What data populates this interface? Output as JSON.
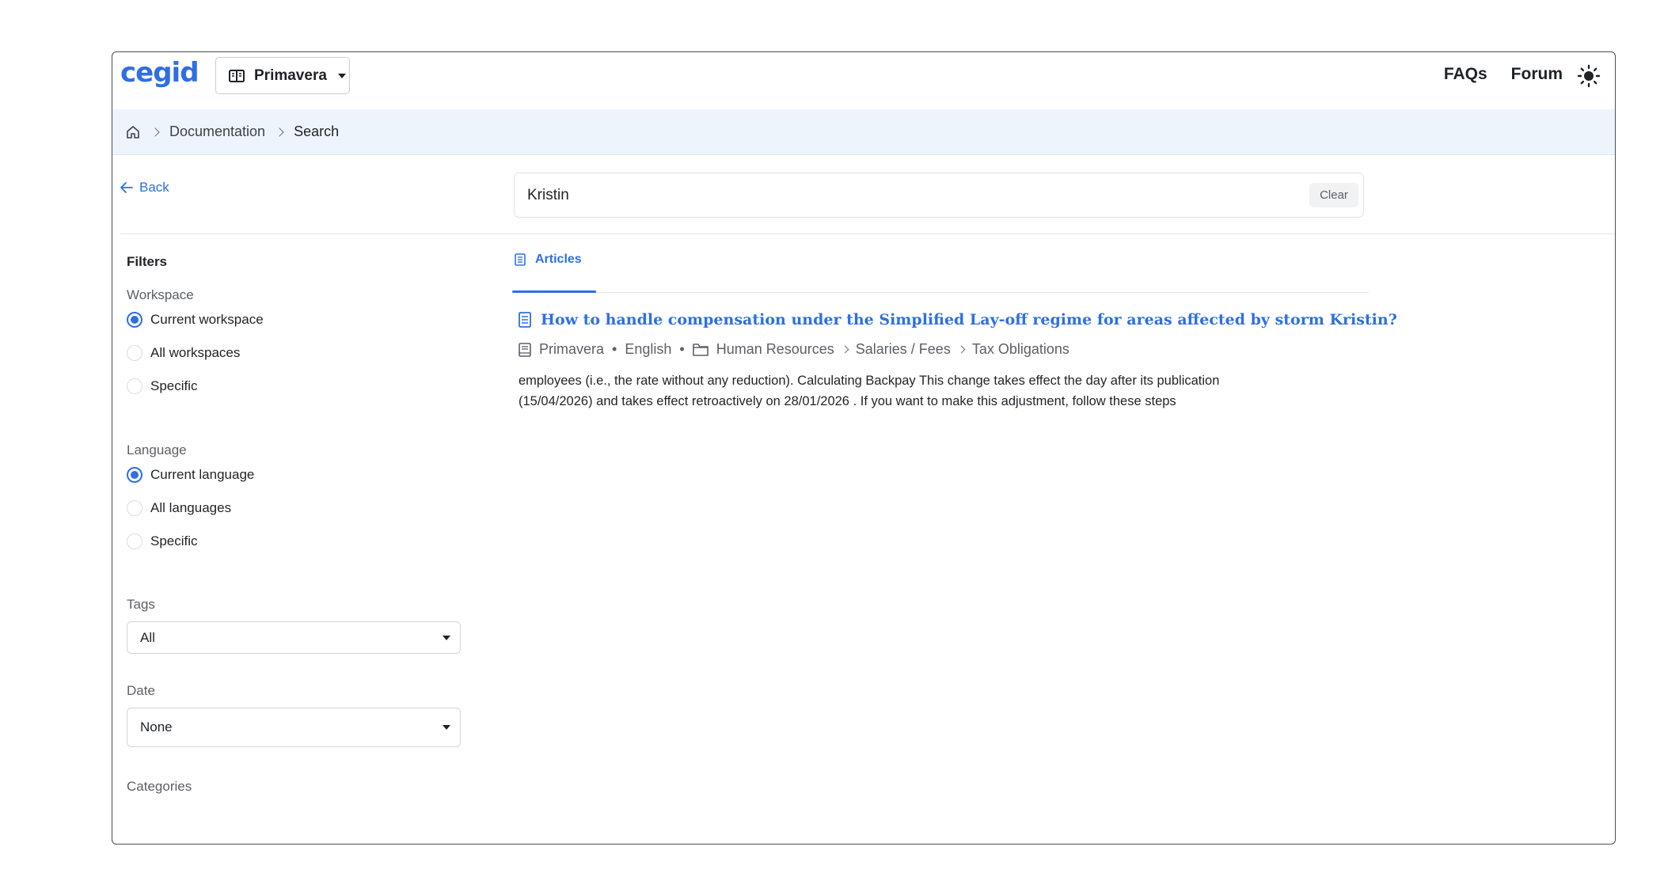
{
  "header": {
    "logo": "cegid",
    "workspace_label": "Primavera",
    "nav": [
      "FAQs",
      "Forum"
    ],
    "theme_icon": "sun-icon"
  },
  "breadcrumb": {
    "home_icon": "home-icon",
    "items": [
      "Documentation",
      "Search"
    ]
  },
  "back_label": "Back",
  "search": {
    "value": "Kristin",
    "clear_label": "Clear"
  },
  "filters": {
    "title": "Filters",
    "workspace": {
      "label": "Workspace",
      "options": [
        "Current workspace",
        "All workspaces",
        "Specific"
      ],
      "selected": "Current workspace"
    },
    "language": {
      "label": "Language",
      "options": [
        "Current language",
        "All languages",
        "Specific"
      ],
      "selected": "Current language"
    },
    "tags": {
      "label": "Tags",
      "value": "All"
    },
    "date": {
      "label": "Date",
      "value": "None"
    },
    "categories": {
      "label": "Categories"
    }
  },
  "tabs": [
    {
      "label": "Articles",
      "active": true
    }
  ],
  "results": [
    {
      "title": "How to handle compensation under the Simplified Lay-off regime for areas affected by storm Kristin?",
      "workspace": "Primavera",
      "language": "English",
      "path": [
        "Human Resources",
        "Salaries / Fees",
        "Tax Obligations"
      ],
      "snippet_line1": "employees (i.e., the rate without any reduction). Calculating Backpay This change takes effect the day after its publication",
      "snippet_line2": "(15/04/2026) and takes effect retroactively on 28/01/2026 . If you want to make this adjustment, follow these steps"
    }
  ],
  "colors": {
    "accent": "#2f6fe4",
    "breadcrumb_bg": "#eef4fb"
  }
}
